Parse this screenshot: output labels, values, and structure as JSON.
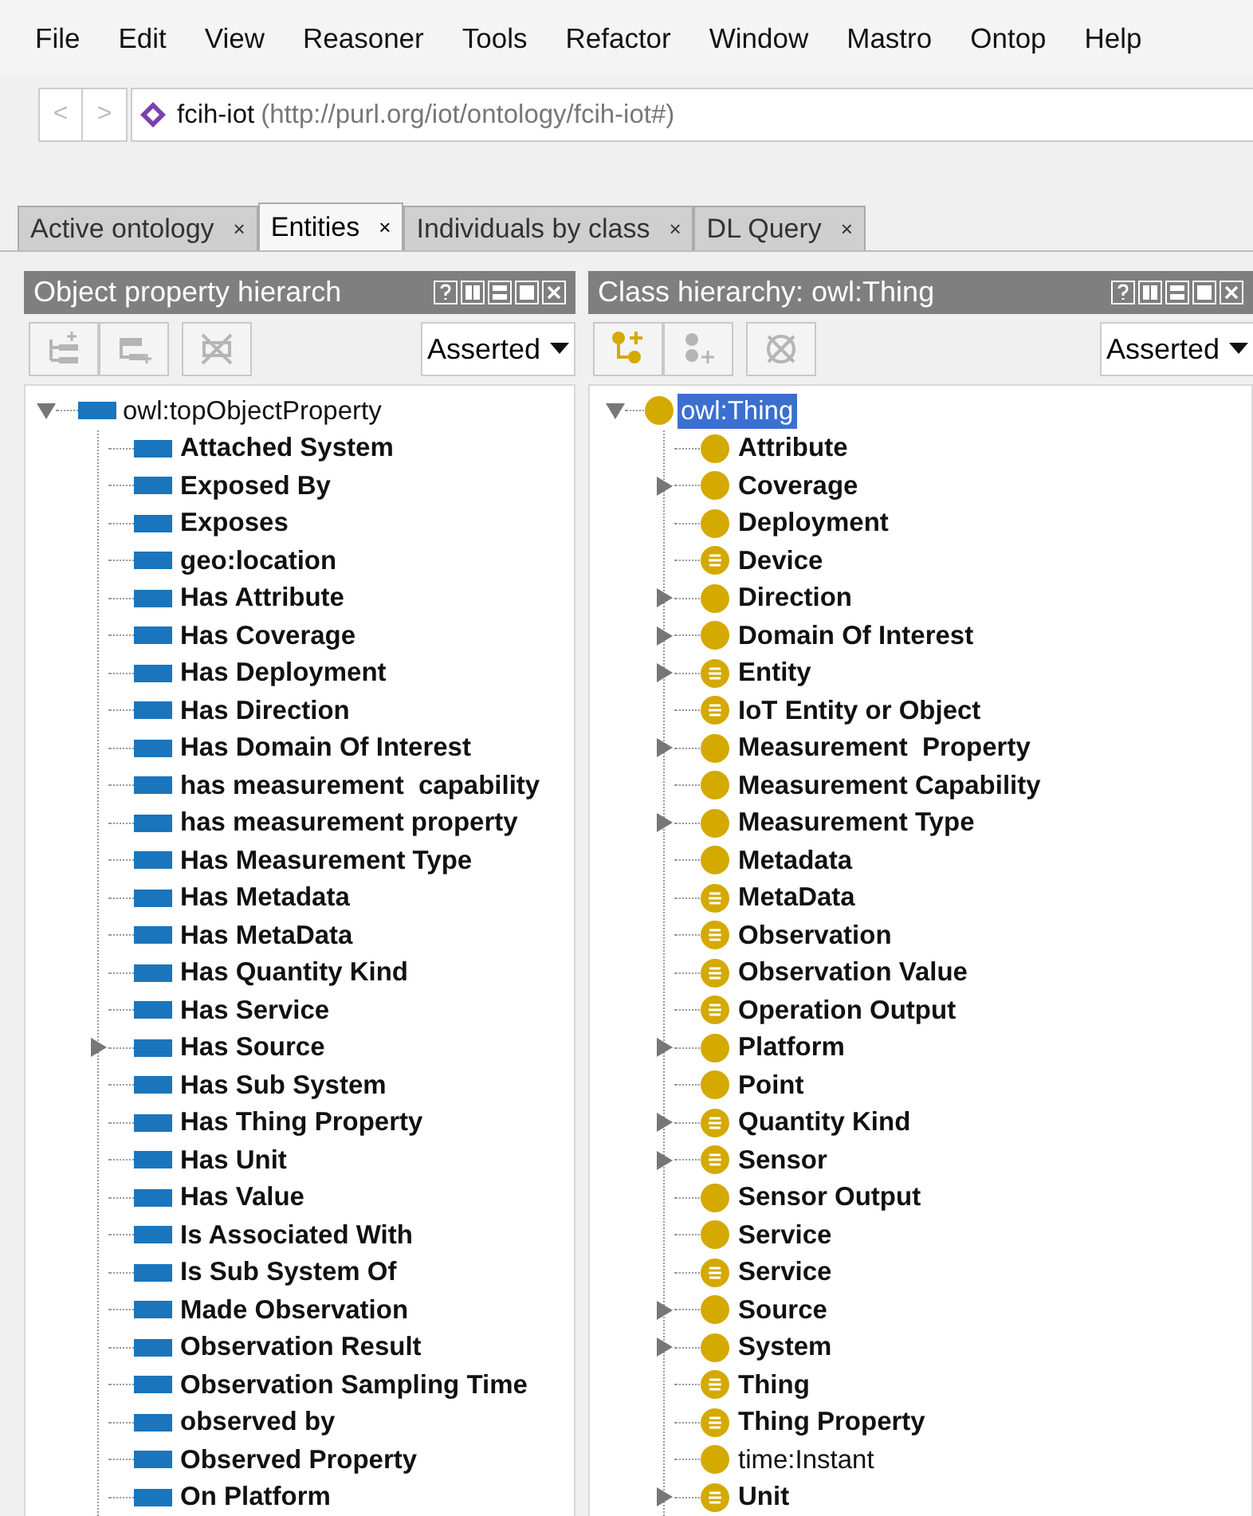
{
  "menu": [
    "File",
    "Edit",
    "View",
    "Reasoner",
    "Tools",
    "Refactor",
    "Window",
    "Mastro",
    "Ontop",
    "Help"
  ],
  "address": {
    "back": "<",
    "forward": ">",
    "name": "fcih-iot",
    "iri": "(http://purl.org/iot/ontology/fcih-iot#)"
  },
  "tabs": [
    {
      "label": "Active ontology",
      "close": "×",
      "selected": false
    },
    {
      "label": "Entities",
      "close": "×",
      "selected": true
    },
    {
      "label": "Individuals by class",
      "close": "×",
      "selected": false
    },
    {
      "label": "DL Query",
      "close": "×",
      "selected": false
    }
  ],
  "panels": [
    {
      "kind": "property",
      "title": "Object property hierarch",
      "tools": [
        {
          "disabled": true
        },
        {
          "disabled": true
        },
        {
          "disabled": true
        }
      ],
      "mode": "Asserted",
      "tree": {
        "label": "owl:topObjectProperty",
        "bold": false,
        "selected": false,
        "expanded": true,
        "children": [
          {
            "label": "Attached System",
            "bold": true,
            "selected": false
          },
          {
            "label": "Exposed By",
            "bold": true,
            "selected": false
          },
          {
            "label": "Exposes",
            "bold": true,
            "selected": false
          },
          {
            "label": "geo:location",
            "bold": true,
            "selected": false
          },
          {
            "label": "Has Attribute",
            "bold": true,
            "selected": false
          },
          {
            "label": "Has Coverage",
            "bold": true,
            "selected": false
          },
          {
            "label": "Has Deployment",
            "bold": true,
            "selected": false
          },
          {
            "label": "Has Direction",
            "bold": true,
            "selected": false
          },
          {
            "label": "Has Domain Of Interest",
            "bold": true,
            "selected": false
          },
          {
            "label": "has measurement  capability",
            "bold": true,
            "selected": false
          },
          {
            "label": "has measurement property",
            "bold": true,
            "selected": false
          },
          {
            "label": "Has Measurement Type",
            "bold": true,
            "selected": false
          },
          {
            "label": "Has Metadata",
            "bold": true,
            "selected": false
          },
          {
            "label": "Has MetaData",
            "bold": true,
            "selected": false
          },
          {
            "label": "Has Quantity Kind",
            "bold": true,
            "selected": false
          },
          {
            "label": "Has Service",
            "bold": true,
            "selected": false
          },
          {
            "label": "Has Source",
            "bold": true,
            "selected": false,
            "expanded": false
          },
          {
            "label": "Has Sub System",
            "bold": true,
            "selected": false
          },
          {
            "label": "Has Thing Property",
            "bold": true,
            "selected": false
          },
          {
            "label": "Has Unit",
            "bold": true,
            "selected": false
          },
          {
            "label": "Has Value",
            "bold": true,
            "selected": false
          },
          {
            "label": "Is Associated With",
            "bold": true,
            "selected": false
          },
          {
            "label": "Is Sub System Of",
            "bold": true,
            "selected": false
          },
          {
            "label": "Made Observation",
            "bold": true,
            "selected": false
          },
          {
            "label": "Observation Result",
            "bold": true,
            "selected": false
          },
          {
            "label": "Observation Sampling Time",
            "bold": true,
            "selected": false
          },
          {
            "label": "observed by",
            "bold": true,
            "selected": false
          },
          {
            "label": "Observed Property",
            "bold": true,
            "selected": false
          },
          {
            "label": "On Platform",
            "bold": true,
            "selected": false
          }
        ]
      }
    },
    {
      "kind": "class",
      "title": "Class hierarchy: owl:Thing",
      "tools": [
        {
          "disabled": false
        },
        {
          "disabled": true
        },
        {
          "disabled": true
        }
      ],
      "mode": "Asserted",
      "tree": {
        "label": "owl:Thing",
        "bold": false,
        "selected": true,
        "expanded": true,
        "kind": "primitive",
        "children": [
          {
            "label": "Attribute",
            "bold": true,
            "selected": false,
            "kind": "primitive"
          },
          {
            "label": "Coverage",
            "bold": true,
            "selected": false,
            "kind": "primitive",
            "expanded": false
          },
          {
            "label": "Deployment",
            "bold": true,
            "selected": false,
            "kind": "primitive"
          },
          {
            "label": "Device",
            "bold": true,
            "selected": false,
            "kind": "defined"
          },
          {
            "label": "Direction",
            "bold": true,
            "selected": false,
            "kind": "primitive",
            "expanded": false
          },
          {
            "label": "Domain Of Interest",
            "bold": true,
            "selected": false,
            "kind": "primitive",
            "expanded": false
          },
          {
            "label": "Entity",
            "bold": true,
            "selected": false,
            "kind": "defined",
            "expanded": false
          },
          {
            "label": "IoT Entity or Object",
            "bold": true,
            "selected": false,
            "kind": "defined"
          },
          {
            "label": "Measurement  Property",
            "bold": true,
            "selected": false,
            "kind": "primitive",
            "expanded": false
          },
          {
            "label": "Measurement Capability",
            "bold": true,
            "selected": false,
            "kind": "primitive"
          },
          {
            "label": "Measurement Type",
            "bold": true,
            "selected": false,
            "kind": "primitive",
            "expanded": false
          },
          {
            "label": "Metadata",
            "bold": true,
            "selected": false,
            "kind": "primitive"
          },
          {
            "label": "MetaData",
            "bold": true,
            "selected": false,
            "kind": "defined"
          },
          {
            "label": "Observation",
            "bold": true,
            "selected": false,
            "kind": "defined"
          },
          {
            "label": "Observation Value",
            "bold": true,
            "selected": false,
            "kind": "defined"
          },
          {
            "label": "Operation Output",
            "bold": true,
            "selected": false,
            "kind": "defined"
          },
          {
            "label": "Platform",
            "bold": true,
            "selected": false,
            "kind": "primitive",
            "expanded": false
          },
          {
            "label": "Point",
            "bold": true,
            "selected": false,
            "kind": "primitive"
          },
          {
            "label": "Quantity Kind",
            "bold": true,
            "selected": false,
            "kind": "defined",
            "expanded": false
          },
          {
            "label": "Sensor",
            "bold": true,
            "selected": false,
            "kind": "defined",
            "expanded": false
          },
          {
            "label": "Sensor Output",
            "bold": true,
            "selected": false,
            "kind": "primitive"
          },
          {
            "label": "Service",
            "bold": true,
            "selected": false,
            "kind": "primitive"
          },
          {
            "label": "Service",
            "bold": true,
            "selected": false,
            "kind": "defined"
          },
          {
            "label": "Source",
            "bold": true,
            "selected": false,
            "kind": "primitive",
            "expanded": false
          },
          {
            "label": "System",
            "bold": true,
            "selected": false,
            "kind": "primitive",
            "expanded": false
          },
          {
            "label": "Thing",
            "bold": true,
            "selected": false,
            "kind": "defined"
          },
          {
            "label": "Thing Property",
            "bold": true,
            "selected": false,
            "kind": "defined"
          },
          {
            "label": "time:Instant",
            "bold": false,
            "selected": false,
            "kind": "primitive"
          },
          {
            "label": "Unit",
            "bold": true,
            "selected": false,
            "kind": "defined",
            "expanded": false
          }
        ]
      }
    }
  ]
}
